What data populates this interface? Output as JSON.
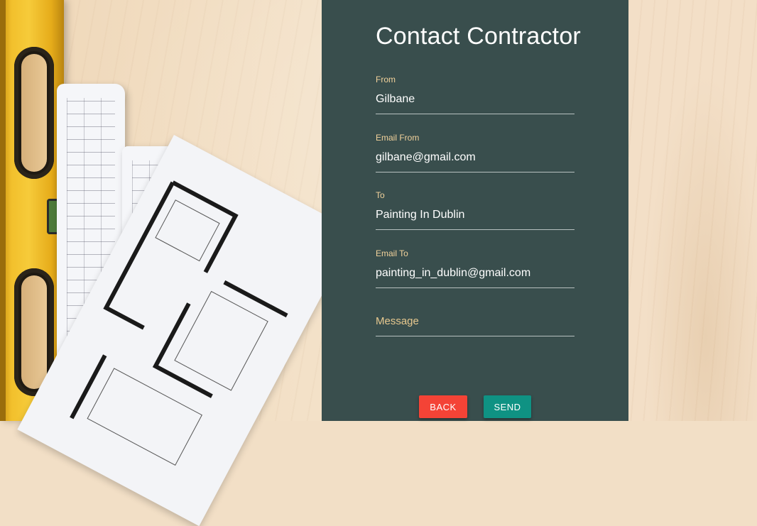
{
  "form": {
    "title": "Contact Contractor",
    "fields": [
      {
        "label": "From",
        "value": "Gilbane"
      },
      {
        "label": "Email From",
        "value": "gilbane@gmail.com"
      },
      {
        "label": "To",
        "value": "Painting In Dublin"
      },
      {
        "label": "Email To",
        "value": "painting_in_dublin@gmail.com"
      },
      {
        "label": "",
        "value": "",
        "placeholder": "Message"
      }
    ],
    "buttons": {
      "back": "BACK",
      "send": "SEND"
    }
  },
  "colors": {
    "panel": "#394e4d",
    "label": "#f2d29b",
    "back_button": "#f44336",
    "send_button": "#0f9283"
  }
}
